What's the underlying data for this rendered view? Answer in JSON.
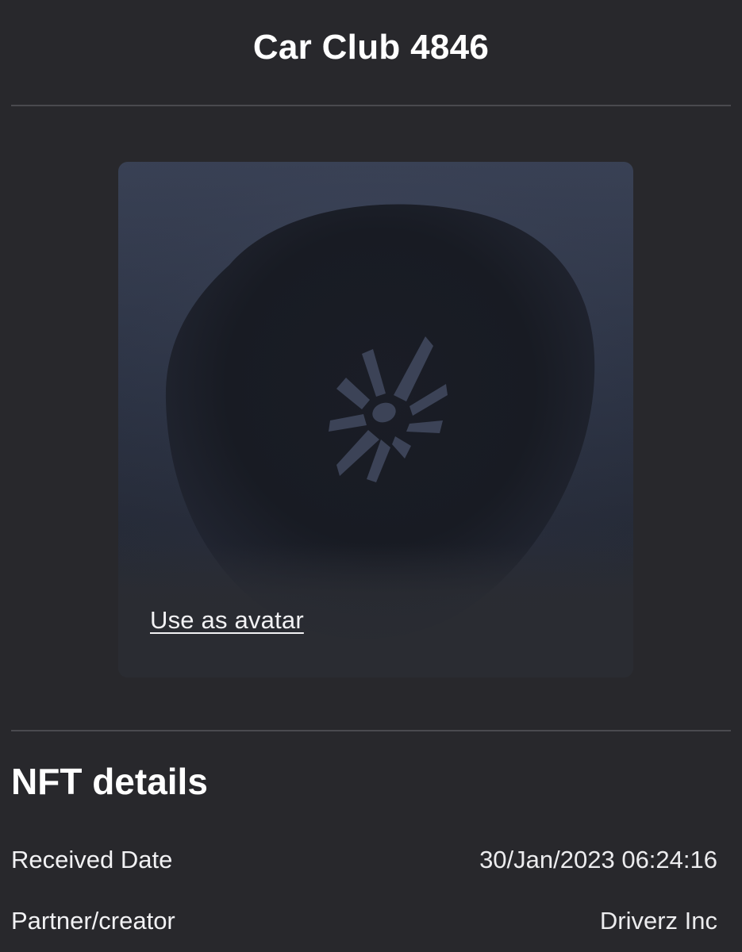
{
  "header": {
    "title": "Car Club 4846"
  },
  "nft": {
    "image_icon": "car-wheel-icon",
    "avatar_link_label": "Use as avatar"
  },
  "details": {
    "title": "NFT details",
    "rows": [
      {
        "label": "Received Date",
        "value": "30/Jan/2023 06:24:16"
      },
      {
        "label": "Partner/creator",
        "value": "Driverz Inc"
      }
    ]
  },
  "colors": {
    "background": "#28282c",
    "divider": "#4a4a4f",
    "text": "#ffffff"
  }
}
